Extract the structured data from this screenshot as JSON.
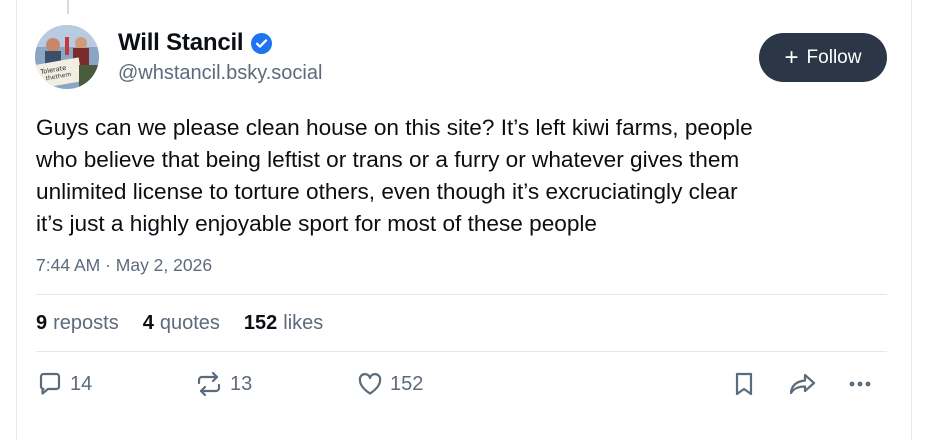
{
  "author": {
    "display_name": "Will Stancil",
    "handle": "@whstancil.bsky.social",
    "verified": true,
    "avatar_sign_text": "Tolerate\nthe\nthem"
  },
  "follow_button": {
    "label": "Follow"
  },
  "post": {
    "text": "Guys can we please clean house on this site? It’s left kiwi farms, people\nwho believe that being leftist or trans or a furry or whatever gives them\nunlimited license to torture others, even though it’s excruciatingly clear\nit’s just a highly enjoyable sport for most of these people",
    "timestamp": "7:44 AM · May 2, 2026"
  },
  "stats": {
    "reposts": {
      "count": "9",
      "label": "reposts"
    },
    "quotes": {
      "count": "4",
      "label": "quotes"
    },
    "likes": {
      "count": "152",
      "label": "likes"
    }
  },
  "actions": {
    "reply": {
      "icon": "reply-icon",
      "count": "14"
    },
    "repost": {
      "icon": "repost-icon",
      "count": "13"
    },
    "like": {
      "icon": "heart-icon",
      "count": "152"
    },
    "bookmark": {
      "icon": "bookmark-icon"
    },
    "share": {
      "icon": "share-icon"
    },
    "more": {
      "icon": "more-icon"
    }
  },
  "colors": {
    "text_primary": "#0b0f14",
    "text_secondary": "#5b6b7c",
    "follow_bg": "#2b3746",
    "verified_blue": "#1d73f0",
    "divider": "#e3e8ee"
  }
}
